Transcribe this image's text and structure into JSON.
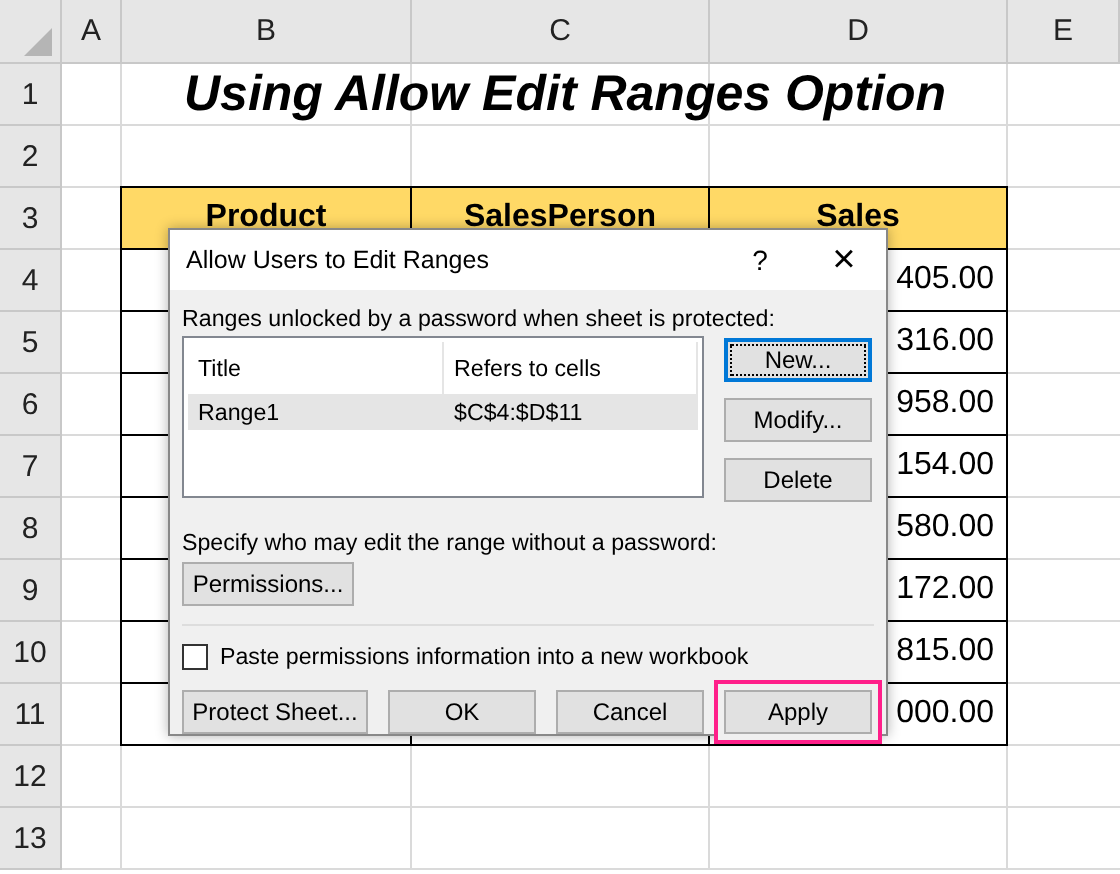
{
  "sheet": {
    "column_headers": [
      "A",
      "B",
      "C",
      "D",
      "E"
    ],
    "row_headers": [
      "1",
      "2",
      "3",
      "4",
      "5",
      "6",
      "7",
      "8",
      "9",
      "10",
      "11",
      "12",
      "13"
    ],
    "title": "Using Allow Edit Ranges Option",
    "table_headers": [
      "Product",
      "SalesPerson",
      "Sales"
    ],
    "sales": [
      "405.00",
      "316.00",
      "958.00",
      "154.00",
      "580.00",
      "172.00",
      "815.00",
      "000.00"
    ]
  },
  "dialog": {
    "title": "Allow Users to Edit Ranges",
    "help": "?",
    "close": "×",
    "ranges_label": "Ranges unlocked by a password when sheet is protected:",
    "list_columns": [
      "Title",
      "Refers to cells"
    ],
    "ranges": [
      {
        "title": "Range1",
        "refers_to": "$C$4:$D$11",
        "selected": true
      }
    ],
    "side_buttons": [
      {
        "label": "New...",
        "focused": true
      },
      {
        "label": "Modify...",
        "focused": false
      },
      {
        "label": "Delete",
        "focused": false
      }
    ],
    "specify_label": "Specify who may edit the range without a password:",
    "permissions_button": "Permissions...",
    "paste_option": {
      "label": "Paste permissions information into a new workbook",
      "checked": false
    },
    "bottom_buttons": [
      {
        "label": "Protect Sheet...",
        "highlighted": false
      },
      {
        "label": "OK",
        "highlighted": false
      },
      {
        "label": "Cancel",
        "highlighted": false
      },
      {
        "label": "Apply",
        "highlighted": true
      }
    ]
  }
}
